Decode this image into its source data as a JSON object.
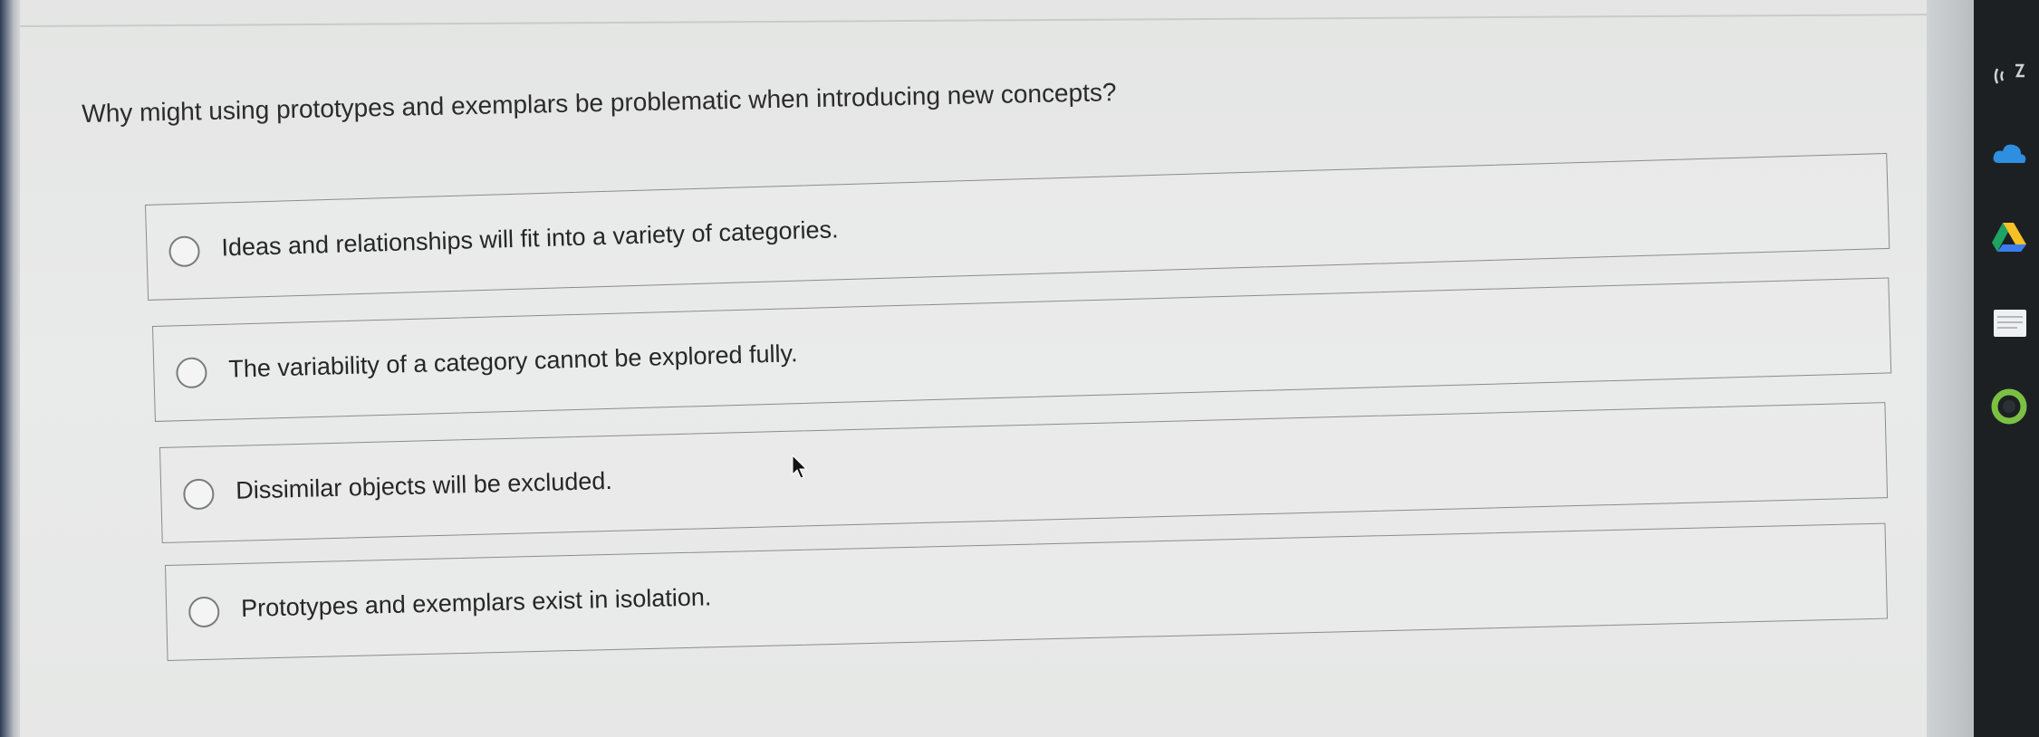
{
  "question": {
    "text": "Why might using prototypes and exemplars be problematic when introducing new concepts?"
  },
  "options": [
    {
      "label": "Ideas and relationships will fit into a variety of categories.",
      "selected": false
    },
    {
      "label": "The variability of a category cannot be explored fully.",
      "selected": false
    },
    {
      "label": "Dissimilar objects will be excluded.",
      "selected": false
    },
    {
      "label": "Prototypes and exemplars exist in isolation.",
      "selected": false
    }
  ],
  "dock": {
    "icons": [
      "wifi-share-icon",
      "cloud-icon",
      "drive-icon",
      "document-icon",
      "circle-app-icon"
    ]
  },
  "colors": {
    "page_background": "#e7e8e7",
    "option_border": "#8a8c8c",
    "text": "#262626",
    "dock_background": "#1d2023"
  }
}
